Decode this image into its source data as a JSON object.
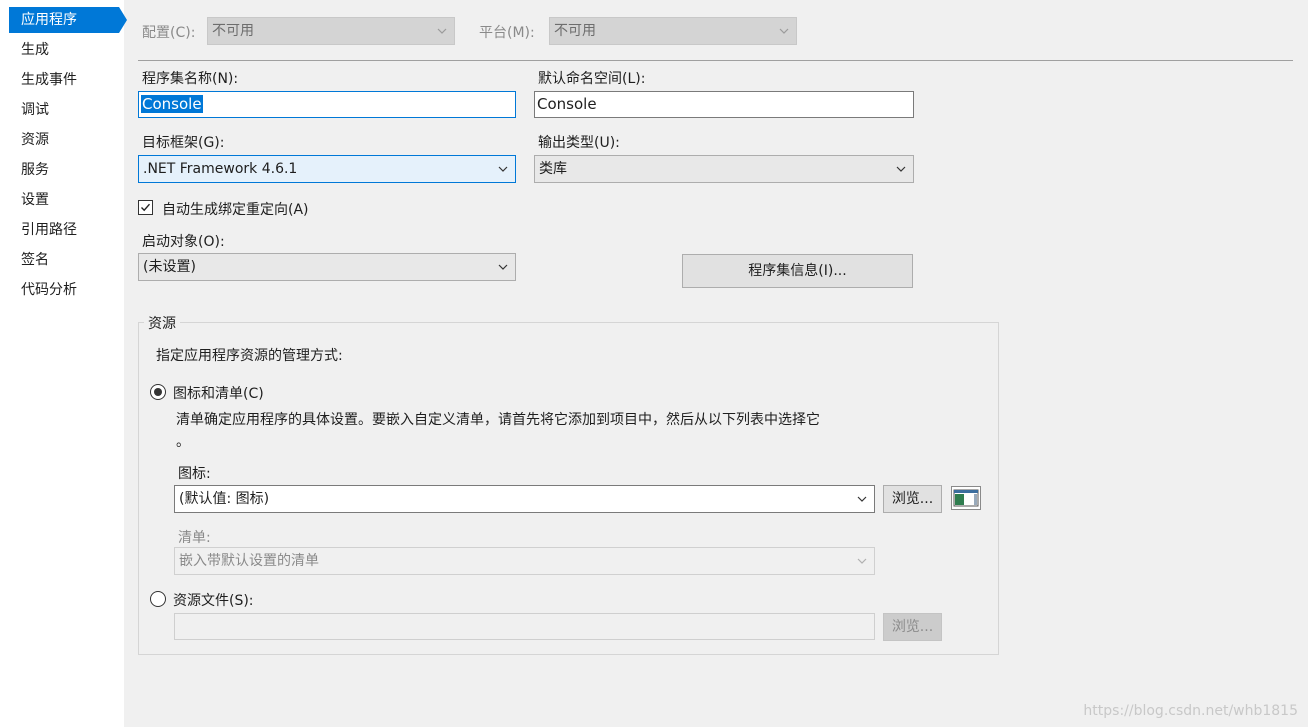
{
  "sidebar": {
    "items": [
      {
        "label": "应用程序",
        "active": true
      },
      {
        "label": "生成"
      },
      {
        "label": "生成事件"
      },
      {
        "label": "调试"
      },
      {
        "label": "资源"
      },
      {
        "label": "服务"
      },
      {
        "label": "设置"
      },
      {
        "label": "引用路径"
      },
      {
        "label": "签名"
      },
      {
        "label": "代码分析"
      }
    ]
  },
  "top": {
    "config_label": "配置(C):",
    "config_value": "不可用",
    "platform_label": "平台(M):",
    "platform_value": "不可用"
  },
  "assembly": {
    "name_label": "程序集名称(N):",
    "name_value": "Console",
    "namespace_label": "默认命名空间(L):",
    "namespace_value": "Console",
    "framework_label": "目标框架(G):",
    "framework_value": ".NET Framework 4.6.1",
    "output_label": "输出类型(U):",
    "output_value": "类库",
    "autobind_label": "自动生成绑定重定向(A)",
    "autobind_checked": true,
    "startup_label": "启动对象(O):",
    "startup_value": "(未设置)",
    "assembly_info_button": "程序集信息(I)..."
  },
  "resources": {
    "group_title": "资源",
    "description": "指定应用程序资源的管理方式:",
    "icon_manifest_radio": "图标和清单(C)",
    "icon_manifest_selected": true,
    "icon_manifest_desc_line1": "清单确定应用程序的具体设置。要嵌入自定义清单，请首先将它添加到项目中，然后从以下列表中选择它",
    "icon_manifest_desc_line2": "。",
    "icon_label": "图标:",
    "icon_value": "(默认值: 图标)",
    "browse_label": "浏览...",
    "manifest_label": "清单:",
    "manifest_value": "嵌入带默认设置的清单",
    "resource_file_radio": "资源文件(S):",
    "resource_file_value": "",
    "resource_browse_label": "浏览..."
  },
  "watermark": "https://blog.csdn.net/whb1815",
  "colors": {
    "accent": "#0078d7",
    "background": "#f0f0f0",
    "sidebar": "#ffffff"
  }
}
